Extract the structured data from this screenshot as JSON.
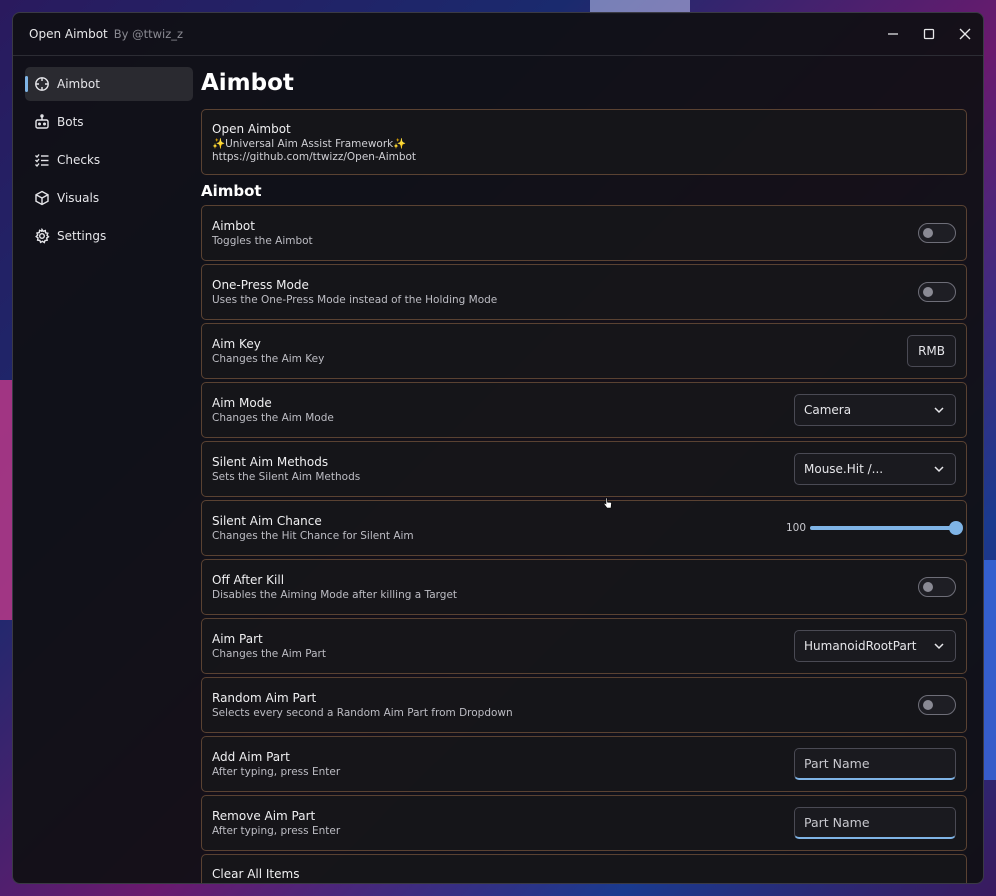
{
  "window": {
    "title": "Open Aimbot",
    "author": "By @ttwiz_z"
  },
  "sidebar": {
    "items": [
      {
        "label": "Aimbot",
        "icon": "crosshair-icon",
        "active": true
      },
      {
        "label": "Bots",
        "icon": "robot-icon",
        "active": false
      },
      {
        "label": "Checks",
        "icon": "checklist-icon",
        "active": false
      },
      {
        "label": "Visuals",
        "icon": "cube-icon",
        "active": false
      },
      {
        "label": "Settings",
        "icon": "gear-icon",
        "active": false
      }
    ]
  },
  "main": {
    "page_title": "Aimbot",
    "info": {
      "title": "Open Aimbot",
      "line1": "✨Universal Aim Assist Framework✨",
      "line2": "https://github.com/ttwizz/Open-Aimbot"
    },
    "section_title": "Aimbot",
    "rows": [
      {
        "title": "Aimbot",
        "subtitle": "Toggles the Aimbot",
        "control": "toggle",
        "value": false
      },
      {
        "title": "One-Press Mode",
        "subtitle": "Uses the One-Press Mode instead of the Holding Mode",
        "control": "toggle",
        "value": false
      },
      {
        "title": "Aim Key",
        "subtitle": "Changes the Aim Key",
        "control": "keybind",
        "value": "RMB"
      },
      {
        "title": "Aim Mode",
        "subtitle": "Changes the Aim Mode",
        "control": "dropdown",
        "value": "Camera"
      },
      {
        "title": "Silent Aim Methods",
        "subtitle": "Sets the Silent Aim Methods",
        "control": "dropdown",
        "value": "Mouse.Hit /..."
      },
      {
        "title": "Silent Aim Chance",
        "subtitle": "Changes the Hit Chance for Silent Aim",
        "control": "slider",
        "value": "100",
        "fraction": 1.0
      },
      {
        "title": "Off After Kill",
        "subtitle": "Disables the Aiming Mode after killing a Target",
        "control": "toggle",
        "value": false
      },
      {
        "title": "Aim Part",
        "subtitle": "Changes the Aim Part",
        "control": "dropdown",
        "value": "HumanoidRootPart"
      },
      {
        "title": "Random Aim Part",
        "subtitle": "Selects every second a Random Aim Part from Dropdown",
        "control": "toggle",
        "value": false
      },
      {
        "title": "Add Aim Part",
        "subtitle": "After typing, press Enter",
        "control": "input",
        "placeholder": "Part Name"
      },
      {
        "title": "Remove Aim Part",
        "subtitle": "After typing, press Enter",
        "control": "input",
        "placeholder": "Part Name"
      },
      {
        "title": "Clear All Items",
        "subtitle": "",
        "control": "button"
      }
    ]
  },
  "colors": {
    "accent": "#7fb4e6",
    "card_border": "#5a4232"
  }
}
